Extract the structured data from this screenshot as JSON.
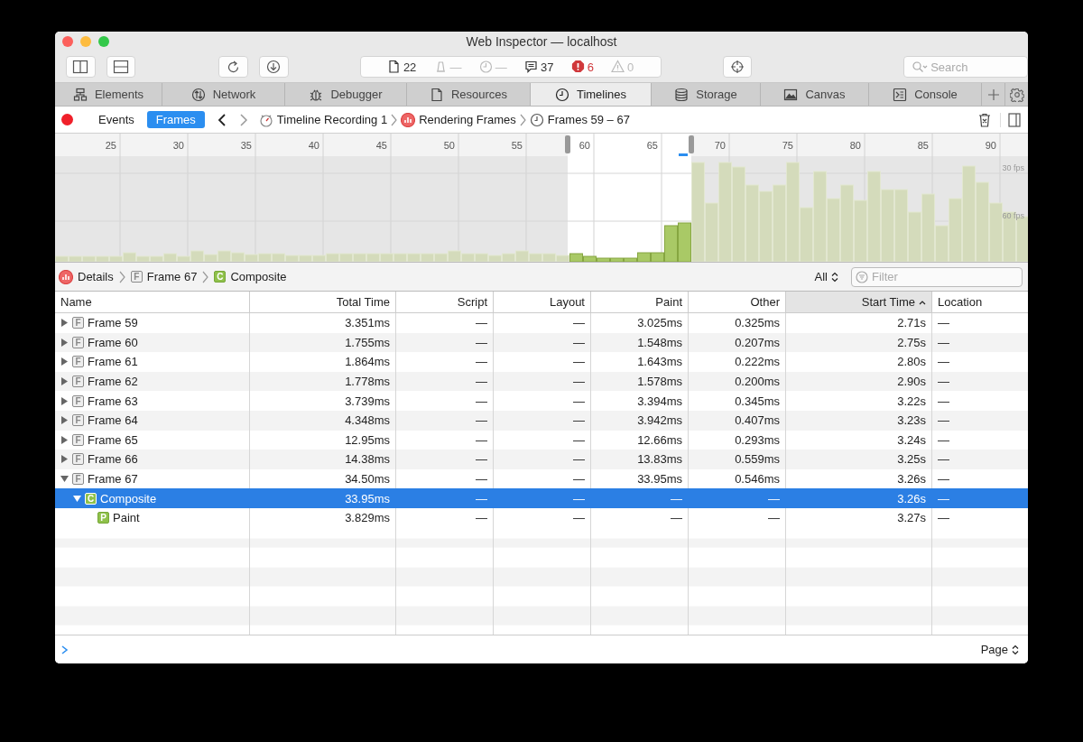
{
  "window": {
    "title": "Web Inspector — localhost"
  },
  "toolbar": {
    "dashboard": [
      {
        "kind": "resources",
        "text": "22",
        "disabled": false
      },
      {
        "kind": "network",
        "text": "—",
        "disabled": true
      },
      {
        "kind": "time",
        "text": "—",
        "disabled": true
      },
      {
        "kind": "logs",
        "text": "37",
        "disabled": false
      },
      {
        "kind": "errors",
        "text": "6",
        "disabled": false
      },
      {
        "kind": "warnings",
        "text": "0",
        "disabled": true
      }
    ],
    "search": {
      "placeholder": "Search"
    }
  },
  "tabs": [
    {
      "kind": "elements",
      "label": "Elements",
      "selected": false
    },
    {
      "kind": "network",
      "label": "Network",
      "selected": false
    },
    {
      "kind": "debugger",
      "label": "Debugger",
      "selected": false
    },
    {
      "kind": "resources",
      "label": "Resources",
      "selected": false
    },
    {
      "kind": "timelines",
      "label": "Timelines",
      "selected": true
    },
    {
      "kind": "storage",
      "label": "Storage",
      "selected": false
    },
    {
      "kind": "canvas",
      "label": "Canvas",
      "selected": false
    },
    {
      "kind": "console",
      "label": "Console",
      "selected": false
    }
  ],
  "subbar": {
    "modes": [
      {
        "label": "Events",
        "selected": false
      },
      {
        "label": "Frames",
        "selected": true
      }
    ],
    "path": [
      {
        "kind": "recording",
        "label": "Timeline Recording 1"
      },
      {
        "kind": "rendering",
        "label": "Rendering Frames"
      },
      {
        "kind": "range",
        "label": "Frames 59 – 67"
      }
    ]
  },
  "overview": {
    "ruler_labels": [
      "25",
      "30",
      "35",
      "40",
      "45",
      "50",
      "55",
      "60",
      "65",
      "70",
      "75",
      "80",
      "85",
      "90"
    ],
    "fps_labels": [
      "30 fps",
      "60 fps"
    ]
  },
  "details_bar": {
    "path": [
      {
        "kind": "details",
        "label": "Details"
      },
      {
        "kind": "frame",
        "badge": "F",
        "label": "Frame 67"
      },
      {
        "kind": "composite",
        "badge": "C",
        "label": "Composite"
      }
    ],
    "scope": "All",
    "filter": {
      "placeholder": "Filter"
    }
  },
  "table": {
    "columns": [
      {
        "label": "Name",
        "sorted": false
      },
      {
        "label": "Total Time",
        "sorted": false
      },
      {
        "label": "Script",
        "sorted": false
      },
      {
        "label": "Layout",
        "sorted": false
      },
      {
        "label": "Paint",
        "sorted": false
      },
      {
        "label": "Other",
        "sorted": false
      },
      {
        "label": "Start Time",
        "sorted": true
      },
      {
        "label": "Location",
        "sorted": false
      }
    ],
    "rows": [
      {
        "kind": "frame",
        "badge": "F",
        "expanded": false,
        "selected": false,
        "cells": [
          "Frame 59",
          "3.351ms",
          "—",
          "—",
          "3.025ms",
          "0.325ms",
          "2.71s",
          "—"
        ]
      },
      {
        "kind": "frame",
        "badge": "F",
        "expanded": false,
        "selected": false,
        "cells": [
          "Frame 60",
          "1.755ms",
          "—",
          "—",
          "1.548ms",
          "0.207ms",
          "2.75s",
          "—"
        ]
      },
      {
        "kind": "frame",
        "badge": "F",
        "expanded": false,
        "selected": false,
        "cells": [
          "Frame 61",
          "1.864ms",
          "—",
          "—",
          "1.643ms",
          "0.222ms",
          "2.80s",
          "—"
        ]
      },
      {
        "kind": "frame",
        "badge": "F",
        "expanded": false,
        "selected": false,
        "cells": [
          "Frame 62",
          "1.778ms",
          "—",
          "—",
          "1.578ms",
          "0.200ms",
          "2.90s",
          "—"
        ]
      },
      {
        "kind": "frame",
        "badge": "F",
        "expanded": false,
        "selected": false,
        "cells": [
          "Frame 63",
          "3.739ms",
          "—",
          "—",
          "3.394ms",
          "0.345ms",
          "3.22s",
          "—"
        ]
      },
      {
        "kind": "frame",
        "badge": "F",
        "expanded": false,
        "selected": false,
        "cells": [
          "Frame 64",
          "4.348ms",
          "—",
          "—",
          "3.942ms",
          "0.407ms",
          "3.23s",
          "—"
        ]
      },
      {
        "kind": "frame",
        "badge": "F",
        "expanded": false,
        "selected": false,
        "cells": [
          "Frame 65",
          "12.95ms",
          "—",
          "—",
          "12.66ms",
          "0.293ms",
          "3.24s",
          "—"
        ]
      },
      {
        "kind": "frame",
        "badge": "F",
        "expanded": false,
        "selected": false,
        "cells": [
          "Frame 66",
          "14.38ms",
          "—",
          "—",
          "13.83ms",
          "0.559ms",
          "3.25s",
          "—"
        ]
      },
      {
        "kind": "frame",
        "badge": "F",
        "expanded": true,
        "selected": false,
        "cells": [
          "Frame 67",
          "34.50ms",
          "—",
          "—",
          "33.95ms",
          "0.546ms",
          "3.26s",
          "—"
        ],
        "children": [
          {
            "kind": "composite",
            "badge": "C",
            "expanded": true,
            "selected": true,
            "cells": [
              "Composite",
              "33.95ms",
              "—",
              "—",
              "—",
              "—",
              "3.26s",
              "—"
            ],
            "children": [
              {
                "kind": "paint",
                "badge": "P",
                "selected": false,
                "cells": [
                  "Paint",
                  "3.829ms",
                  "—",
                  "—",
                  "—",
                  "—",
                  "3.27s",
                  "—"
                ]
              }
            ]
          }
        ]
      }
    ]
  },
  "console": {
    "mode": "Page"
  }
}
